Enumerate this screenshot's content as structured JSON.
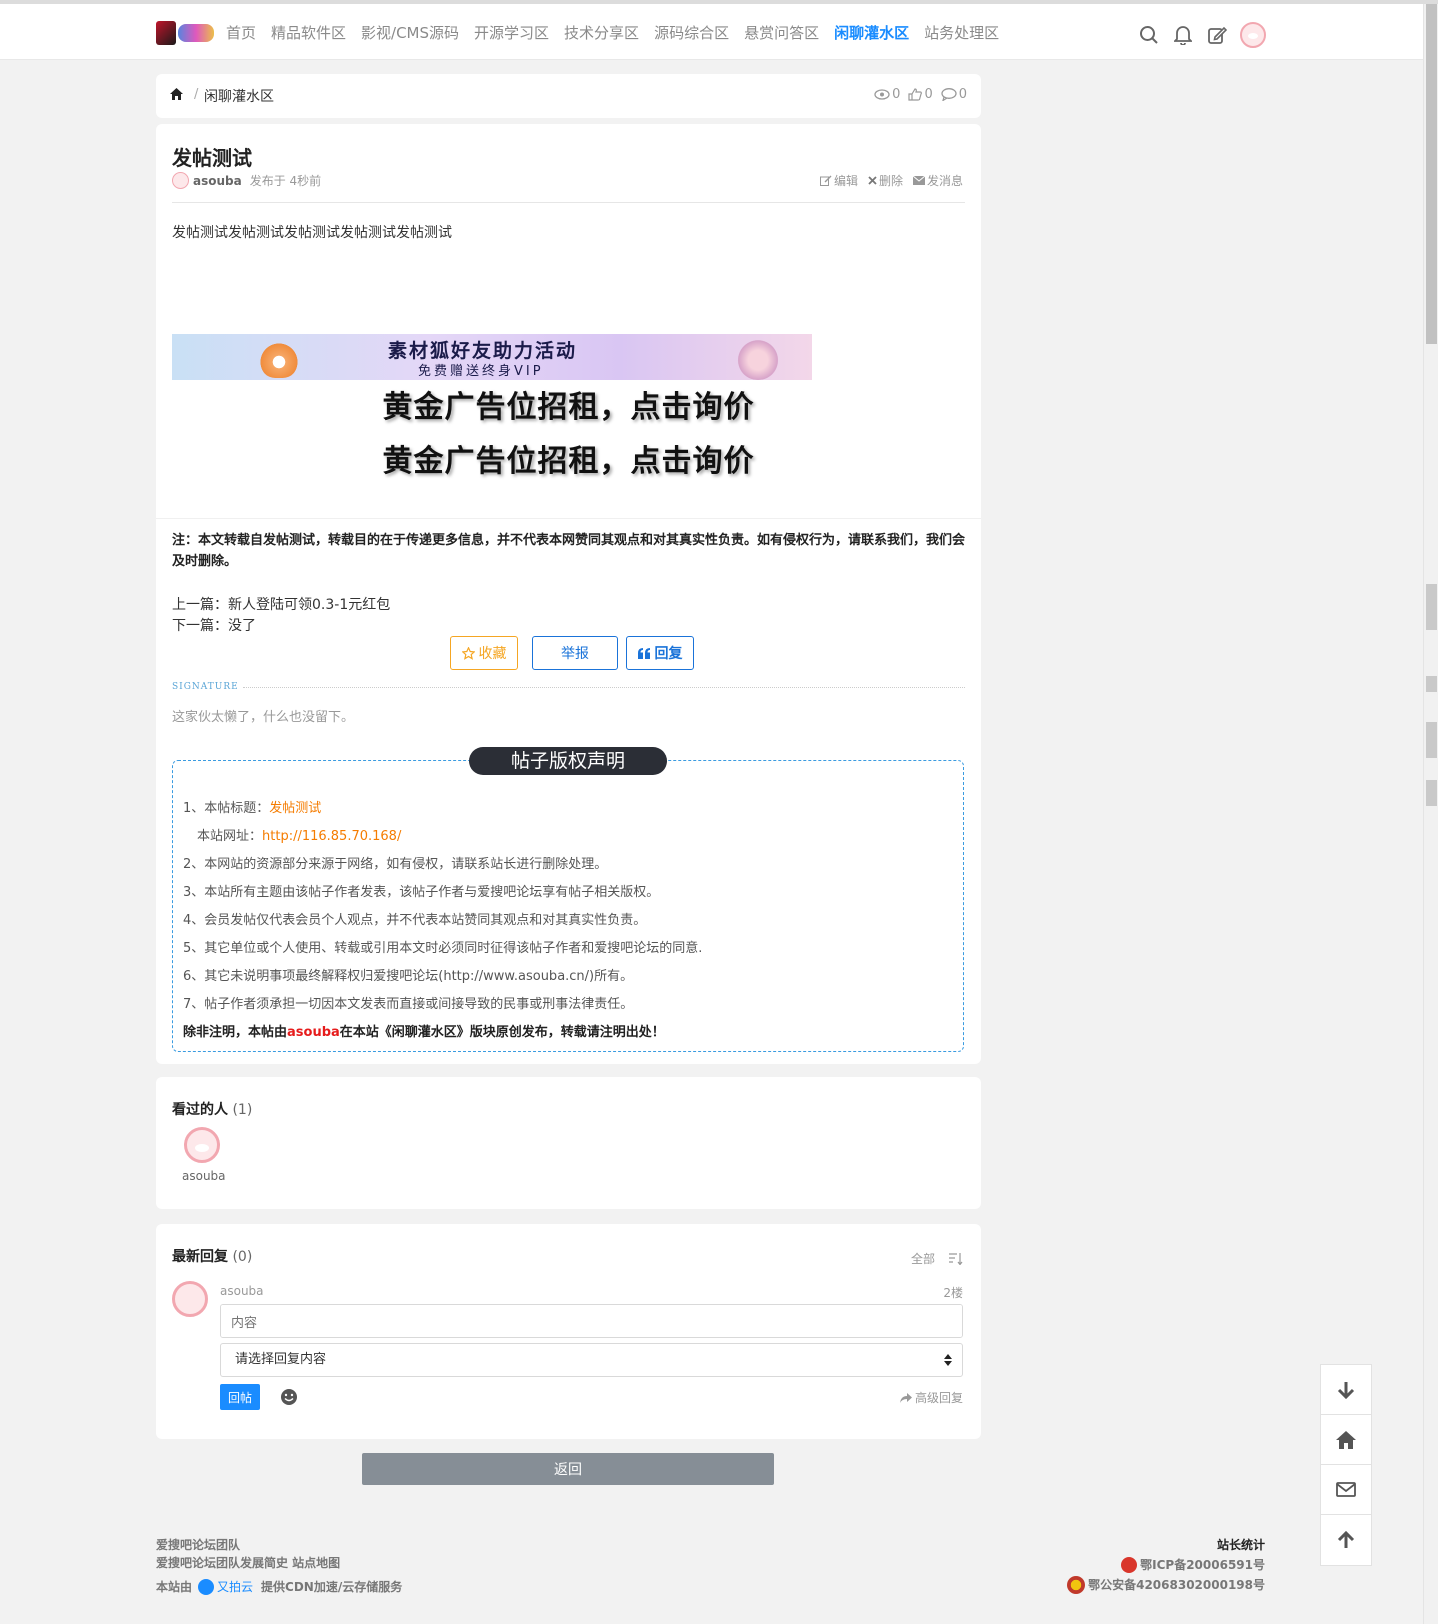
{
  "header": {
    "nav": [
      "首页",
      "精品软件区",
      "影视/CMS源码",
      "开源学习区",
      "技术分享区",
      "源码综合区",
      "悬赏问答区",
      "闲聊灌水区",
      "站务处理区"
    ],
    "active_nav": "闲聊灌水区",
    "icons": [
      "search-icon",
      "bell-icon",
      "edit-icon",
      "avatar"
    ]
  },
  "breadcrumb": {
    "current": "闲聊灌水区",
    "views": "0",
    "likes": "0",
    "comments": "0"
  },
  "post": {
    "title": "发帖测试",
    "author": "asouba",
    "time": "发布于 4秒前",
    "actions": {
      "edit": "编辑",
      "delete": "删除",
      "message": "发消息"
    },
    "body": "发帖测试发帖测试发帖测试发帖测试发帖测试",
    "banner": {
      "line1": "素材狐好友助力活动",
      "line2": "免费赠送终身VIP"
    },
    "ad_line1": "黄金广告位招租，点击询价",
    "ad_line2": "黄金广告位招租，点击询价",
    "note": "注：本文转载自发帖测试，转载目的在于传递更多信息，并不代表本网赞同其观点和对其真实性负责。如有侵权行为，请联系我们，我们会及时删除。",
    "prev": "上一篇：新人登陆可领0.3-1元红包",
    "next": "下一篇：没了",
    "buttons": {
      "favorite": "收藏",
      "report": "举报",
      "reply": "回复"
    },
    "signature_label": "SIGNATURE",
    "signature_text": "这家伙太懒了，什么也没留下。"
  },
  "copyright": {
    "title": "帖子版权声明",
    "item1_prefix": "1、本帖标题：",
    "item1_value": "发帖测试",
    "url_prefix": "本站网址：",
    "url_value": "http://116.85.70.168/",
    "item2": "2、本网站的资源部分来源于网络，如有侵权，请联系站长进行删除处理。",
    "item3": "3、本站所有主题由该帖子作者发表，该帖子作者与爱搜吧论坛享有帖子相关版权。",
    "item4": "4、会员发帖仅代表会员个人观点，并不代表本站赞同其观点和对其真实性负责。",
    "item5": "5、其它单位或个人使用、转载或引用本文时必须同时征得该帖子作者和爱搜吧论坛的同意.",
    "item6": "6、其它未说明事项最终解释权归爱搜吧论坛(http://www.asouba.cn/)所有。",
    "item7": "7、帖子作者须承担一切因本文发表而直接或间接导致的民事或刑事法律责任。",
    "final_a": "除非注明，本帖由",
    "final_author": "asouba",
    "final_b": "在本站《闲聊灌水区》版块原创发布，转载请注明出处！"
  },
  "viewers": {
    "title": "看过的人",
    "count": "(1)",
    "list": [
      {
        "name": "asouba"
      }
    ]
  },
  "replies": {
    "title": "最新回复",
    "count": "(0)",
    "filter": "全部",
    "user": "asouba",
    "floor": "2楼",
    "placeholder": "内容",
    "select_value": "请选择回复内容",
    "submit": "回帖",
    "advanced": "高级回复"
  },
  "back": "返回",
  "footer": {
    "team": "爱搜吧论坛团队",
    "links": "爱搜吧论坛团队发展简史 站点地图",
    "cdn_prefix": "本站由",
    "cdn_name": "又拍云",
    "cdn_suffix": "提供CDN加速/云存储服务",
    "stats": "站长统计",
    "icp": "鄂ICP备20006591号",
    "gov": "鄂公安备42068302000198号"
  },
  "colors": {
    "accent": "#1a8cff",
    "orange": "#f57c00",
    "fav": "#f5a623",
    "red": "#e61c1c"
  }
}
